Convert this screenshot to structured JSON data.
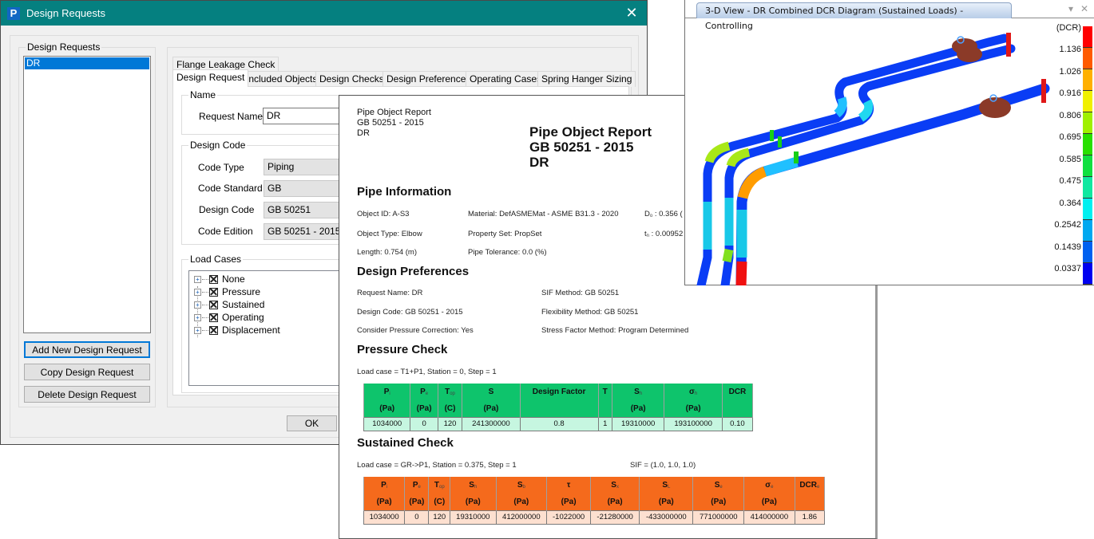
{
  "dialog": {
    "title": "Design Requests",
    "app_icon": "P",
    "close_icon": "✕",
    "list_group_label": "Design Requests",
    "requests": [
      "DR"
    ],
    "buttons": {
      "add": "Add New Design Request",
      "copy": "Copy Design Request",
      "delete": "Delete Design Request",
      "ok": "OK"
    },
    "tabs_row1": [
      "Flange Leakage Check"
    ],
    "tabs_row2": [
      "Design Request",
      "Included Objects",
      "Design Checks",
      "Design Preferences",
      "Operating Cases",
      "Spring Hanger Sizing"
    ],
    "active_tab": "Design Request",
    "name_group": {
      "label": "Name",
      "request_name_label": "Request Name",
      "request_name_value": "DR"
    },
    "design_code_group": {
      "label": "Design Code",
      "fields": [
        {
          "label": "Code Type",
          "value": "Piping"
        },
        {
          "label": "Code Standard",
          "value": "GB"
        },
        {
          "label": "Design Code",
          "value": "GB 50251"
        },
        {
          "label": "Code Edition",
          "value": "GB 50251 - 2015"
        }
      ]
    },
    "load_cases_group": {
      "label": "Load Cases",
      "items": [
        {
          "label": "None",
          "checked": true
        },
        {
          "label": "Pressure",
          "checked": true
        },
        {
          "label": "Sustained",
          "checked": true
        },
        {
          "label": "Operating",
          "checked": true
        },
        {
          "label": "Displacement",
          "checked": true
        }
      ]
    }
  },
  "report": {
    "header_small": [
      "Pipe Object Report",
      "GB 50251 - 2015",
      "DR"
    ],
    "header_big": [
      "Pipe Object Report",
      "GB 50251 - 2015",
      "DR"
    ],
    "pipe_info": {
      "title": "Pipe Information",
      "col1": [
        "Object ID: A-S3",
        "Object Type: Elbow",
        "Length: 0.754 (m)"
      ],
      "col2": [
        "Material: DefASMEMat - ASME B31.3 - 2020",
        "Property Set: PropSet",
        "Pipe Tolerance: 0.0 (%)"
      ],
      "col3": [
        {
          "main": "D",
          "sub": "o",
          "rest": " : 0.356 ("
        },
        {
          "main": "t",
          "sub": "n",
          "rest": " : 0.00952"
        }
      ]
    },
    "design_prefs": {
      "title": "Design Preferences",
      "col1": [
        "Request Name: DR",
        "Design Code: GB 50251 - 2015",
        "Consider Pressure Correction: Yes"
      ],
      "col2": [
        "SIF Method: GB 50251",
        "Flexibility Method: GB 50251",
        "Stress Factor Method: Program Determined"
      ]
    },
    "pressure_check": {
      "title": "Pressure Check",
      "load_case": "Load case = T1+P1, Station = 0, Step = 1",
      "headers": [
        {
          "main": "P",
          "sub": "i",
          "unit": "(Pa)"
        },
        {
          "main": "P",
          "sub": "e",
          "unit": "(Pa)"
        },
        {
          "main": "T",
          "sub": "op",
          "unit": "(C)"
        },
        {
          "main": "S",
          "sub": "",
          "unit": "(Pa)"
        },
        {
          "main": "Design Factor",
          "sub": "",
          "unit": ""
        },
        {
          "main": "T",
          "sub": "",
          "unit": ""
        },
        {
          "main": "S",
          "sub": "h",
          "unit": "(Pa)"
        },
        {
          "main": "σ",
          "sub": "h",
          "unit": "(Pa)"
        },
        {
          "main": "DCR",
          "sub": "",
          "unit": ""
        }
      ],
      "values": [
        "1034000",
        "0",
        "120",
        "241300000",
        "0.8",
        "1",
        "19310000",
        "193100000",
        "0.10"
      ],
      "header_color": "#0ec46c",
      "row_color": "#c6f6e0"
    },
    "sustained_check": {
      "title": "Sustained Check",
      "load_case": "Load case = GR->P1, Station = 0.375, Step = 1",
      "sif": "SIF = (1.0, 1.0, 1.0)",
      "headers": [
        {
          "main": "P",
          "sub": "i",
          "unit": "(Pa)"
        },
        {
          "main": "P",
          "sub": "e",
          "unit": "(Pa)"
        },
        {
          "main": "T",
          "sub": "op",
          "unit": "(C)"
        },
        {
          "main": "S",
          "sub": "h",
          "unit": "(Pa)"
        },
        {
          "main": "S",
          "sub": "b",
          "unit": "(Pa)"
        },
        {
          "main": "τ",
          "sub": "",
          "unit": "(Pa)"
        },
        {
          "main": "S",
          "sub": "x",
          "unit": "(Pa)"
        },
        {
          "main": "S",
          "sub": "L",
          "unit": "(Pa)"
        },
        {
          "main": "S",
          "sub": "e",
          "unit": "(Pa)"
        },
        {
          "main": "σ",
          "sub": "e",
          "unit": "(Pa)"
        },
        {
          "main": "DCR",
          "sub": "e",
          "unit": ""
        }
      ],
      "values": [
        "1034000",
        "0",
        "120",
        "19310000",
        "412000000",
        "-1022000",
        "-21280000",
        "-433000000",
        "771000000",
        "414000000",
        "1.86"
      ],
      "header_color": "#f56a1c",
      "row_color": "#fde0d0"
    }
  },
  "view3d": {
    "tab_title": "3-D View - DR Combined DCR Diagram (Sustained Loads) - Controlling",
    "dropdown_icon": "▾",
    "close_icon": "✕",
    "legend": {
      "unit": "(DCR)",
      "labels": [
        "1.136",
        "1.026",
        "0.916",
        "0.806",
        "0.695",
        "0.585",
        "0.475",
        "0.364",
        "0.2542",
        "0.1439",
        "0.0337"
      ],
      "colors": [
        "#ff0000",
        "#ff5a00",
        "#ffb000",
        "#f0f000",
        "#a0f000",
        "#28e000",
        "#10e040",
        "#10e8a0",
        "#00f0f0",
        "#00a8f0",
        "#0060f0",
        "#0000f0"
      ]
    }
  }
}
